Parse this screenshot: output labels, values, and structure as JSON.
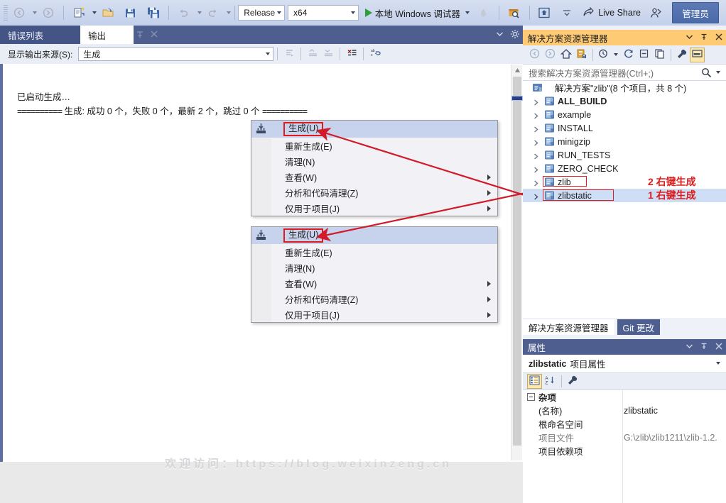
{
  "toolbar": {
    "nav_back_icon": "navigate-back-icon",
    "nav_forward_icon": "navigate-forward-icon",
    "new_item_icon": "new-item-icon",
    "open_icon": "open-folder-icon",
    "save_icon": "save-icon",
    "save_all_icon": "save-all-icon",
    "undo_icon": "undo-icon",
    "redo_icon": "redo-icon",
    "configuration": "Release",
    "platform": "x64",
    "run_label": "本地 Windows 调试器",
    "play_icon": "play-icon",
    "hot_reload_icon": "hot-reload-icon",
    "search_tool_icon": "search-tool-icon",
    "preview_icon": "preview-window-icon",
    "overflow_icon": "toolbar-overflow-icon",
    "live_share": "Live Share",
    "live_share_icon": "live-share-icon",
    "feedback_icon": "feedback-icon",
    "admin": "管理员"
  },
  "output_panel": {
    "tabs": [
      {
        "label": "错误列表",
        "active": false
      },
      {
        "label": "输出",
        "active": true
      }
    ],
    "pin_icon": "pin-icon",
    "close_icon": "close-icon",
    "dropdown_icon": "chevron-down-icon",
    "settings_icon": "gear-icon",
    "source_label": "显示输出来源(S):",
    "source_value": "生成",
    "toolbar_icons": [
      "navigate-to-message-icon",
      "previous-message-icon",
      "next-message-icon",
      "clear-all-icon",
      "toggle-word-wrap-icon"
    ],
    "lines": [
      "已启动生成…",
      "生成: 成功 0 个，失败 0 个，最新 2 个，跳过 0 个"
    ],
    "line2_prefix": "==========",
    "line2_suffix": "=========="
  },
  "context_menus": [
    {
      "id": "menu-zlibstatic",
      "items": [
        {
          "label": "生成(U)",
          "highlighted": true,
          "submenu": false,
          "icon": "build-icon"
        },
        {
          "label": "重新生成(E)",
          "highlighted": false,
          "submenu": false
        },
        {
          "label": "清理(N)",
          "highlighted": false,
          "submenu": false
        },
        {
          "label": "查看(W)",
          "highlighted": false,
          "submenu": true
        },
        {
          "label": "分析和代码清理(Z)",
          "highlighted": false,
          "submenu": true
        },
        {
          "label": "仅用于项目(J)",
          "highlighted": false,
          "submenu": true
        }
      ]
    },
    {
      "id": "menu-zlib",
      "items": [
        {
          "label": "生成(U)",
          "highlighted": true,
          "submenu": false,
          "icon": "build-icon"
        },
        {
          "label": "重新生成(E)",
          "highlighted": false,
          "submenu": false
        },
        {
          "label": "清理(N)",
          "highlighted": false,
          "submenu": false
        },
        {
          "label": "查看(W)",
          "highlighted": false,
          "submenu": true
        },
        {
          "label": "分析和代码清理(Z)",
          "highlighted": false,
          "submenu": true
        },
        {
          "label": "仅用于项目(J)",
          "highlighted": false,
          "submenu": true
        }
      ]
    }
  ],
  "solution_explorer": {
    "title": "解决方案资源管理器",
    "title_dropdown_icon": "chevron-down-icon",
    "title_pin_icon": "pin-icon",
    "title_close_icon": "close-icon",
    "toolbar_icons": [
      "back-icon",
      "forward-icon",
      "home-icon",
      "sync-with-active-document-icon",
      "pending-changes-filter-icon",
      "refresh-icon",
      "collapse-all-icon",
      "show-all-files-icon",
      "properties-icon",
      "preview-selected-items-icon"
    ],
    "search_placeholder": "搜索解决方案资源管理器(Ctrl+;)",
    "search_icon": "search-icon",
    "search_caret_icon": "chevron-down-icon",
    "root": "解决方案\"zlib\"(8 个项目，共 8 个)",
    "root_icon": "solution-icon",
    "nodes": [
      {
        "label": "ALL_BUILD",
        "bold": true,
        "selected": false,
        "boxed": false,
        "annotation": ""
      },
      {
        "label": "example",
        "bold": false,
        "selected": false,
        "boxed": false,
        "annotation": ""
      },
      {
        "label": "INSTALL",
        "bold": false,
        "selected": false,
        "boxed": false,
        "annotation": ""
      },
      {
        "label": "minigzip",
        "bold": false,
        "selected": false,
        "boxed": false,
        "annotation": ""
      },
      {
        "label": "RUN_TESTS",
        "bold": false,
        "selected": false,
        "boxed": false,
        "annotation": ""
      },
      {
        "label": "ZERO_CHECK",
        "bold": false,
        "selected": false,
        "boxed": false,
        "annotation": ""
      },
      {
        "label": "zlib",
        "bold": false,
        "selected": false,
        "boxed": true,
        "annotation": "2 右键生成"
      },
      {
        "label": "zlibstatic",
        "bold": false,
        "selected": true,
        "boxed": true,
        "annotation": "1 右键生成"
      }
    ],
    "bottom_tabs": [
      {
        "label": "解决方案资源管理器",
        "active": true
      },
      {
        "label": "Git 更改",
        "active": false
      }
    ]
  },
  "properties": {
    "title": "属性",
    "title_dropdown_icon": "chevron-down-icon",
    "title_pin_icon": "pin-icon",
    "title_close_icon": "close-icon",
    "object_name": "zlibstatic",
    "object_suffix": "项目属性",
    "object_caret_icon": "chevron-down-icon",
    "toolbar_icons": [
      "categorized-icon",
      "alphabetical-icon",
      "property-pages-icon"
    ],
    "group": "杂项",
    "rows": [
      {
        "key": "(名称)",
        "value": "zlibstatic",
        "dim": false
      },
      {
        "key": "根命名空间",
        "value": "",
        "dim": false
      },
      {
        "key": "项目文件",
        "value": "G:\\zlib\\zlib1211\\zlib-1.2.",
        "dim": true
      },
      {
        "key": "项目依赖项",
        "value": "",
        "dim": false
      }
    ]
  },
  "watermark": "欢迎访问：https://blog.weixinzeng.cn",
  "colors": {
    "accent_orange": "#ffca74",
    "title_blue": "#4e5f8f",
    "annotation_red": "#e01b1b",
    "menu_highlight": "#c7d2ec",
    "selection_blue": "#cddef5",
    "play_green": "#2e9d3a"
  }
}
